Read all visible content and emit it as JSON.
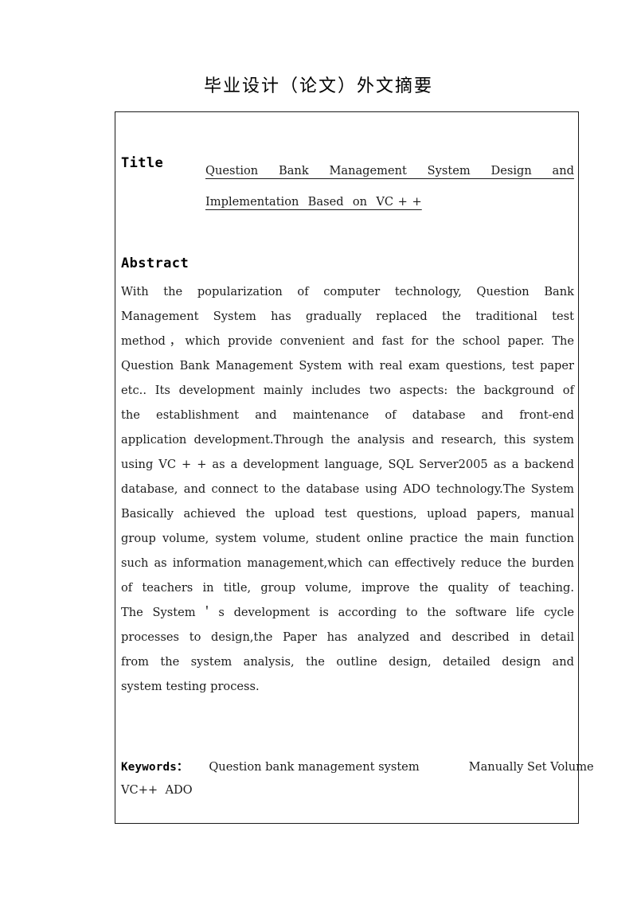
{
  "page": {
    "heading": "毕业设计（论文）外文摘要"
  },
  "title_field": {
    "label": "Title",
    "line1": "Question Bank Management System Design and",
    "line2": "Implementation  Based  on  VC + +",
    "full_value": "Question Bank Management System Design and Implementation Based on VC + +"
  },
  "abstract": {
    "heading": "Abstract",
    "lines": [
      "With the popularization of computer technology, Question Bank",
      "Management System has gradually replaced the traditional test",
      "method，which  provide convenient and fast for the school paper. The",
      "Question Bank Management System with real exam questions, test paper",
      "etc.. Its development mainly includes two aspects: the background of",
      "the establishment and maintenance of database and front-end",
      "application development.Through the analysis and research, this system",
      "using VC + + as a development language, SQL Server2005 as a backend",
      "database, and connect to the database using ADO technology.The System",
      "Basically achieved the upload test questions, upload papers, manual",
      "group volume, system volume, student online practice the main function",
      "such as information management,which can effectively reduce the burden",
      "of teachers in title, group volume, improve the quality of teaching.",
      "The System＇s development  is according to the software life cycle",
      "processes to design,the Paper  has analyzed and described in detail",
      "from the system analysis, the outline design, detailed design and",
      "system testing process."
    ],
    "full_text": "With the popularization of computer technology, Question Bank Management System has gradually replaced the traditional test method，which provide convenient and fast for the school paper. The Question Bank Management System with real exam questions, test paper etc.. Its development mainly includes two aspects: the background of the establishment and maintenance of database and front-end application development.Through the analysis and research, this system using VC + + as a development language, SQL Server2005 as a backend database, and connect to the database using ADO technology.The System Basically achieved the upload test questions, upload papers, manual group volume, system volume, student online practice the main function such as information management,which can effectively reduce the burden of teachers in title, group volume, improve the quality of teaching. The System＇s development is according to the software life cycle processes to design,the Paper has analyzed and described in detail from the system analysis, the outline design, detailed design and system testing process."
  },
  "keywords": {
    "label": "Keywords：",
    "line1_term1": "Question bank management system",
    "line1_term2": "Manually Set Volume",
    "line2": "VC++  ADO",
    "all": [
      "Question bank management system",
      "Manually Set Volume",
      "VC++",
      "ADO"
    ]
  },
  "style": {
    "text_color": "#1b1b1b",
    "border_color": "#1a1a1a",
    "background": "#ffffff"
  }
}
